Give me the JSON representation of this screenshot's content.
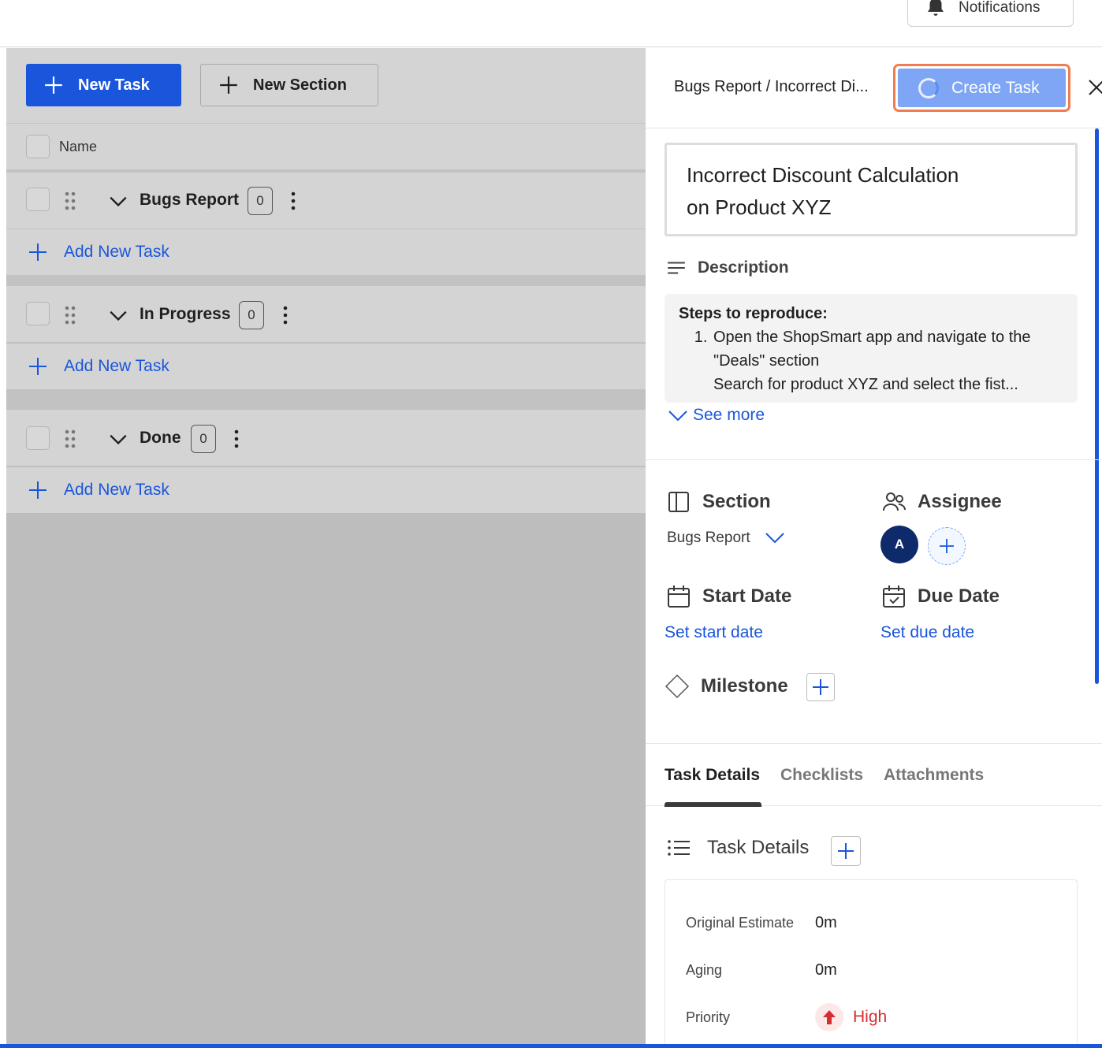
{
  "topbar": {
    "notifications_label": "Notifications"
  },
  "toolbar": {
    "new_task_label": "New Task",
    "new_section_label": "New Section"
  },
  "list": {
    "name_header": "Name",
    "sections": [
      {
        "title": "Bugs Report",
        "count": "0",
        "add_label": "Add New Task"
      },
      {
        "title": "In Progress",
        "count": "0",
        "add_label": "Add New Task"
      },
      {
        "title": "Done",
        "count": "0",
        "add_label": "Add New Task"
      }
    ]
  },
  "panel": {
    "breadcrumb": "Bugs Report  / Incorrect Di...",
    "create_button_label": "Create Task",
    "task_title_line1": "Incorrect Discount Calculation",
    "task_title_line2": "on Product XYZ",
    "description_label": "Description",
    "description": {
      "heading": "Steps to reproduce:",
      "steps": [
        "Open the ShopSmart app and navigate to the \"Deals\" section",
        "Search for product XYZ and select the fist..."
      ]
    },
    "see_more_label": "See more",
    "section_label": "Section",
    "section_value": "Bugs Report",
    "assignee_label": "Assignee",
    "assignee_initial": "A",
    "start_date_label": "Start Date",
    "start_date_link": "Set start date",
    "due_date_label": "Due Date",
    "due_date_link": "Set due date",
    "milestone_label": "Milestone",
    "tabs": [
      {
        "label": "Task Details",
        "active": true
      },
      {
        "label": "Checklists",
        "active": false
      },
      {
        "label": "Attachments",
        "active": false
      }
    ],
    "task_details_heading": "Task Details",
    "task_details": [
      {
        "key": "Original Estimate",
        "value": "0m"
      },
      {
        "key": "Aging",
        "value": "0m"
      },
      {
        "key": "Priority",
        "value": "High"
      }
    ]
  },
  "colors": {
    "primary": "#1a56db",
    "create_button_bg": "#7fa6f5",
    "focus_ring": "#f07c50",
    "priority_high": "#d32f2f",
    "avatar_bg": "#0f2a6b"
  }
}
